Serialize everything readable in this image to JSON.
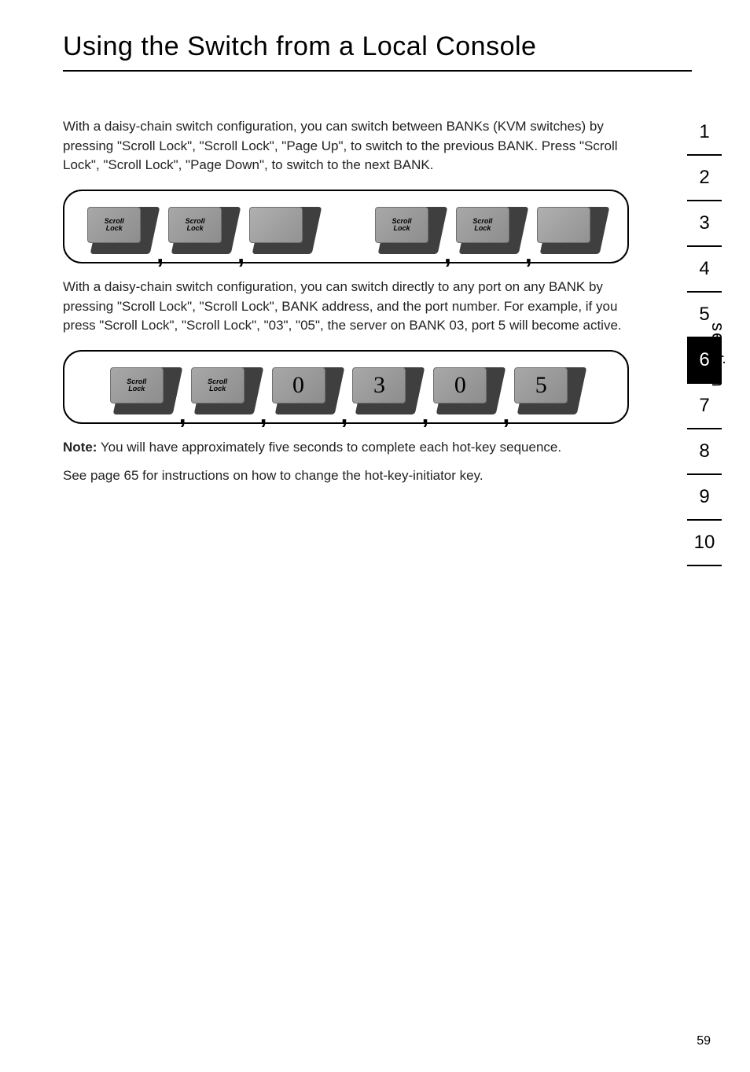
{
  "title": "Using the Switch from a Local Console",
  "para1": "With a daisy-chain switch configuration, you can switch between BANKs (KVM switches) by pressing \"Scroll Lock\", \"Scroll Lock\", \"Page Up\", to switch to the previous BANK. Press \"Scroll Lock\", \"Scroll Lock\", \"Page Down\", to switch to the next BANK.",
  "diagram1": {
    "keys_left": [
      "Scroll\nLock",
      "Scroll\nLock",
      ""
    ],
    "keys_right": [
      "Scroll\nLock",
      "Scroll\nLock",
      ""
    ]
  },
  "para2": "With a daisy-chain switch configuration, you can switch directly to any port on any BANK by pressing \"Scroll Lock\", \"Scroll Lock\", BANK address, and the port number. For example, if you press \"Scroll Lock\", \"Scroll Lock\", \"03\", \"05\", the server on BANK 03, port 5 will become active.",
  "diagram2": {
    "keys": [
      "Scroll\nLock",
      "Scroll\nLock",
      "0",
      "3",
      "0",
      "5"
    ]
  },
  "note_label": "Note:",
  "note_text": " You will have approximately five seconds to complete each hot-key sequence.",
  "see_text": "See page 65 for instructions on how to change the hot-key-initiator key.",
  "nav": {
    "items": [
      "1",
      "2",
      "3",
      "4",
      "5",
      "6",
      "7",
      "8",
      "9",
      "10"
    ],
    "active": "6",
    "label": "section"
  },
  "page_number": "59",
  "comma": ","
}
